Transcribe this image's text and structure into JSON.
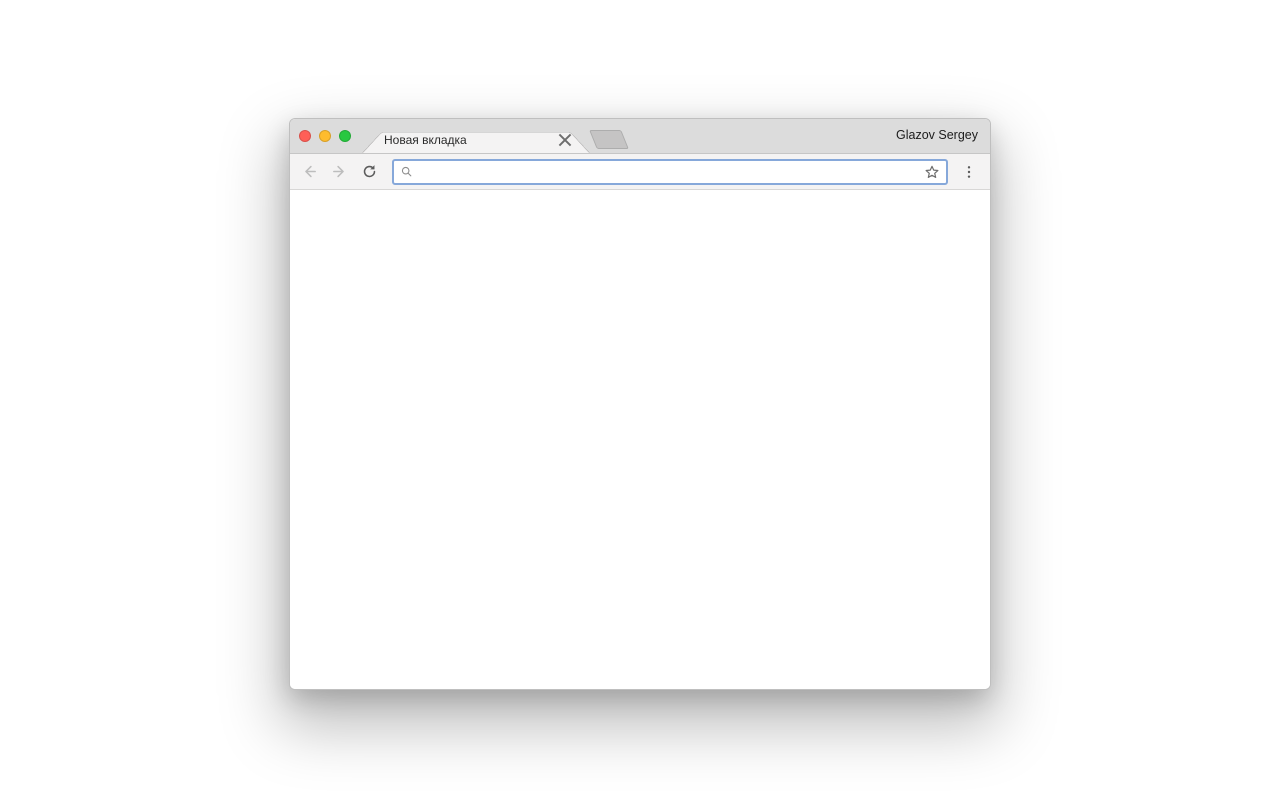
{
  "window": {
    "profile_name": "Glazov Sergey"
  },
  "tabs": {
    "active": {
      "title": "Новая вкладка"
    }
  },
  "omnibox": {
    "value": "",
    "placeholder": ""
  },
  "nav": {
    "back_enabled": false,
    "forward_enabled": false
  }
}
